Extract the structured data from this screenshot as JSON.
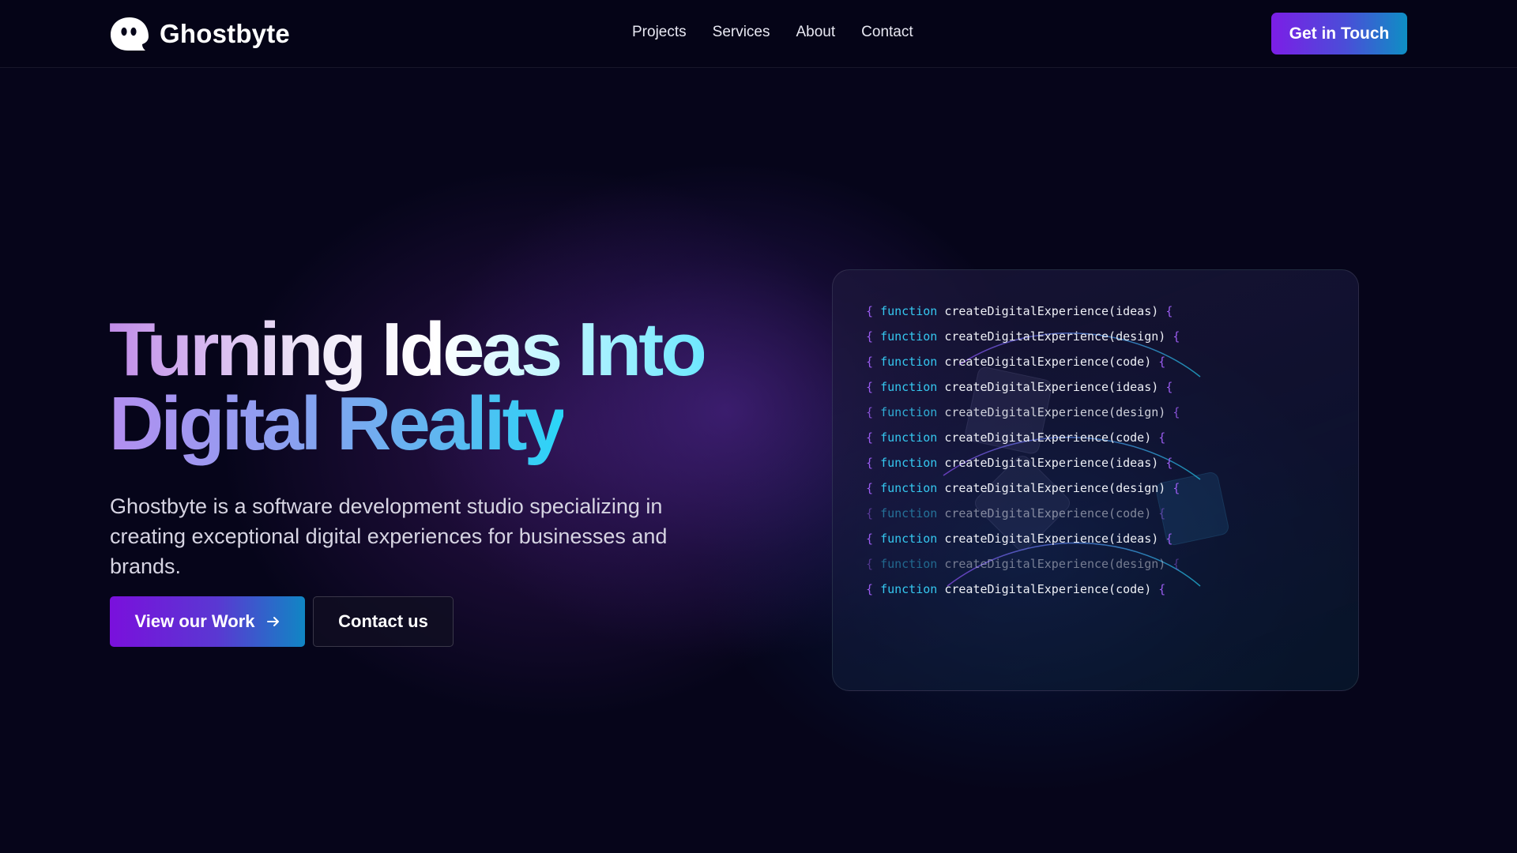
{
  "brand": {
    "name": "Ghostbyte",
    "logo_icon": "ghost-icon"
  },
  "nav": {
    "links": [
      "Projects",
      "Services",
      "About",
      "Contact"
    ],
    "cta_label": "Get in Touch"
  },
  "hero": {
    "title_line1_a": "Turning Ideas Into",
    "title_line2": "Digital Reality",
    "description": "Ghostbyte is a software development studio specializing in creating exceptional digital experiences for businesses and brands.",
    "primary_button": "View our Work",
    "primary_button_icon": "arrow-right-icon",
    "secondary_button": "Contact us"
  },
  "code_card": {
    "lines": [
      {
        "open": "{",
        "keyword": "function",
        "call": "createDigitalExperience(ideas)",
        "close": "{",
        "opacity": 1
      },
      {
        "open": "{",
        "keyword": "function",
        "call": "createDigitalExperience(design)",
        "close": "{",
        "opacity": 1
      },
      {
        "open": "{",
        "keyword": "function",
        "call": "createDigitalExperience(code)",
        "close": "{",
        "opacity": 1
      },
      {
        "open": "{",
        "keyword": "function",
        "call": "createDigitalExperience(ideas)",
        "close": "{",
        "opacity": 1
      },
      {
        "open": "{",
        "keyword": "function",
        "call": "createDigitalExperience(design)",
        "close": "{",
        "opacity": 0.85
      },
      {
        "open": "{",
        "keyword": "function",
        "call": "createDigitalExperience(code)",
        "close": "{",
        "opacity": 1
      },
      {
        "open": "{",
        "keyword": "function",
        "call": "createDigitalExperience(ideas)",
        "close": "{",
        "opacity": 1
      },
      {
        "open": "{",
        "keyword": "function",
        "call": "createDigitalExperience(design)",
        "close": "{",
        "opacity": 1
      },
      {
        "open": "{",
        "keyword": "function",
        "call": "createDigitalExperience(code)",
        "close": "{",
        "opacity": 0.5
      },
      {
        "open": "{",
        "keyword": "function",
        "call": "createDigitalExperience(ideas)",
        "close": "{",
        "opacity": 1
      },
      {
        "open": "{",
        "keyword": "function",
        "call": "createDigitalExperience(design)",
        "close": "{",
        "opacity": 0.45
      },
      {
        "open": "{",
        "keyword": "function",
        "call": "createDigitalExperience(code)",
        "close": "{",
        "opacity": 1
      }
    ]
  },
  "colors": {
    "background": "#06051a",
    "accent_purple": "#7c1ee6",
    "accent_cyan": "#0e8fc4",
    "code_keyword": "#35c8f0",
    "code_brace": "#9b5cf0"
  }
}
